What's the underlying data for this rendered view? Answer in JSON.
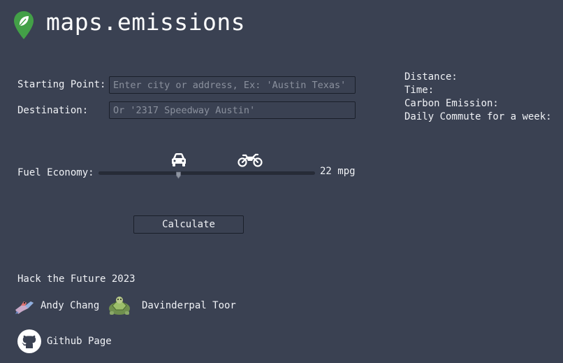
{
  "header": {
    "app_title": "maps.emissions",
    "logo_icon": "leaf-map-pin-icon",
    "accent_color": "#43a047"
  },
  "form": {
    "start_label": "Starting Point:",
    "start_placeholder": "Enter city or address, Ex: 'Austin Texas'",
    "start_value": "",
    "dest_label": "Destination:",
    "dest_placeholder": "Or '2317 Speedway Austin'",
    "dest_value": "",
    "fuel_label": "Fuel Economy:",
    "fuel_value_text": "22 mpg",
    "fuel_value": 22,
    "vehicle_icons": [
      "car-icon",
      "motorcycle-icon"
    ],
    "calculate_label": "Calculate"
  },
  "results": {
    "distance_label": "Distance:",
    "time_label": "Time:",
    "carbon_label": "Carbon Emission:",
    "commute_label": "Daily Commute for a week:"
  },
  "footer": {
    "event": "Hack the Future 2023",
    "members": [
      {
        "name": "Andy Chang",
        "avatar": "bird-avatar-icon"
      },
      {
        "name": "Davinderpal Toor",
        "avatar": "turtle-avatar-icon"
      }
    ],
    "github_label": "Github Page",
    "github_icon": "github-icon"
  }
}
